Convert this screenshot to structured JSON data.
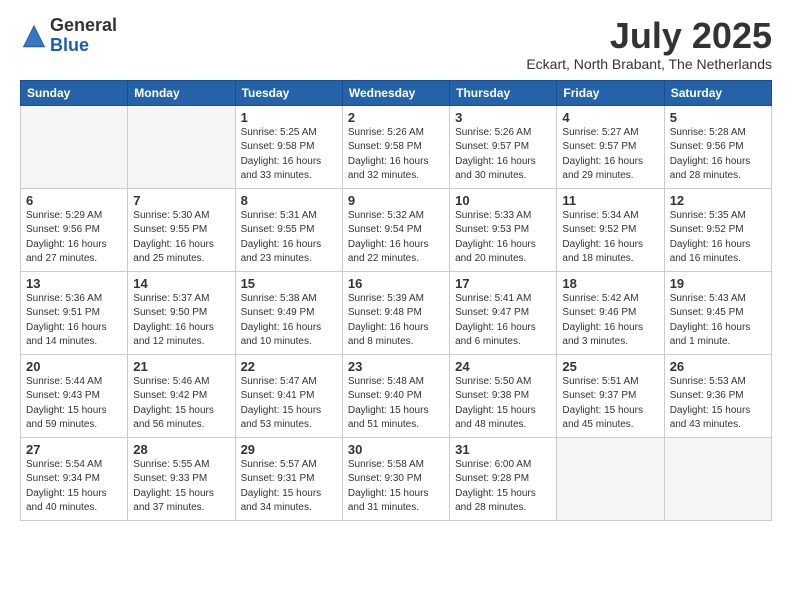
{
  "logo": {
    "general": "General",
    "blue": "Blue"
  },
  "title": "July 2025",
  "subtitle": "Eckart, North Brabant, The Netherlands",
  "headers": [
    "Sunday",
    "Monday",
    "Tuesday",
    "Wednesday",
    "Thursday",
    "Friday",
    "Saturday"
  ],
  "weeks": [
    [
      {
        "day": "",
        "info": ""
      },
      {
        "day": "",
        "info": ""
      },
      {
        "day": "1",
        "info": "Sunrise: 5:25 AM\nSunset: 9:58 PM\nDaylight: 16 hours\nand 33 minutes."
      },
      {
        "day": "2",
        "info": "Sunrise: 5:26 AM\nSunset: 9:58 PM\nDaylight: 16 hours\nand 32 minutes."
      },
      {
        "day": "3",
        "info": "Sunrise: 5:26 AM\nSunset: 9:57 PM\nDaylight: 16 hours\nand 30 minutes."
      },
      {
        "day": "4",
        "info": "Sunrise: 5:27 AM\nSunset: 9:57 PM\nDaylight: 16 hours\nand 29 minutes."
      },
      {
        "day": "5",
        "info": "Sunrise: 5:28 AM\nSunset: 9:56 PM\nDaylight: 16 hours\nand 28 minutes."
      }
    ],
    [
      {
        "day": "6",
        "info": "Sunrise: 5:29 AM\nSunset: 9:56 PM\nDaylight: 16 hours\nand 27 minutes."
      },
      {
        "day": "7",
        "info": "Sunrise: 5:30 AM\nSunset: 9:55 PM\nDaylight: 16 hours\nand 25 minutes."
      },
      {
        "day": "8",
        "info": "Sunrise: 5:31 AM\nSunset: 9:55 PM\nDaylight: 16 hours\nand 23 minutes."
      },
      {
        "day": "9",
        "info": "Sunrise: 5:32 AM\nSunset: 9:54 PM\nDaylight: 16 hours\nand 22 minutes."
      },
      {
        "day": "10",
        "info": "Sunrise: 5:33 AM\nSunset: 9:53 PM\nDaylight: 16 hours\nand 20 minutes."
      },
      {
        "day": "11",
        "info": "Sunrise: 5:34 AM\nSunset: 9:52 PM\nDaylight: 16 hours\nand 18 minutes."
      },
      {
        "day": "12",
        "info": "Sunrise: 5:35 AM\nSunset: 9:52 PM\nDaylight: 16 hours\nand 16 minutes."
      }
    ],
    [
      {
        "day": "13",
        "info": "Sunrise: 5:36 AM\nSunset: 9:51 PM\nDaylight: 16 hours\nand 14 minutes."
      },
      {
        "day": "14",
        "info": "Sunrise: 5:37 AM\nSunset: 9:50 PM\nDaylight: 16 hours\nand 12 minutes."
      },
      {
        "day": "15",
        "info": "Sunrise: 5:38 AM\nSunset: 9:49 PM\nDaylight: 16 hours\nand 10 minutes."
      },
      {
        "day": "16",
        "info": "Sunrise: 5:39 AM\nSunset: 9:48 PM\nDaylight: 16 hours\nand 8 minutes."
      },
      {
        "day": "17",
        "info": "Sunrise: 5:41 AM\nSunset: 9:47 PM\nDaylight: 16 hours\nand 6 minutes."
      },
      {
        "day": "18",
        "info": "Sunrise: 5:42 AM\nSunset: 9:46 PM\nDaylight: 16 hours\nand 3 minutes."
      },
      {
        "day": "19",
        "info": "Sunrise: 5:43 AM\nSunset: 9:45 PM\nDaylight: 16 hours\nand 1 minute."
      }
    ],
    [
      {
        "day": "20",
        "info": "Sunrise: 5:44 AM\nSunset: 9:43 PM\nDaylight: 15 hours\nand 59 minutes."
      },
      {
        "day": "21",
        "info": "Sunrise: 5:46 AM\nSunset: 9:42 PM\nDaylight: 15 hours\nand 56 minutes."
      },
      {
        "day": "22",
        "info": "Sunrise: 5:47 AM\nSunset: 9:41 PM\nDaylight: 15 hours\nand 53 minutes."
      },
      {
        "day": "23",
        "info": "Sunrise: 5:48 AM\nSunset: 9:40 PM\nDaylight: 15 hours\nand 51 minutes."
      },
      {
        "day": "24",
        "info": "Sunrise: 5:50 AM\nSunset: 9:38 PM\nDaylight: 15 hours\nand 48 minutes."
      },
      {
        "day": "25",
        "info": "Sunrise: 5:51 AM\nSunset: 9:37 PM\nDaylight: 15 hours\nand 45 minutes."
      },
      {
        "day": "26",
        "info": "Sunrise: 5:53 AM\nSunset: 9:36 PM\nDaylight: 15 hours\nand 43 minutes."
      }
    ],
    [
      {
        "day": "27",
        "info": "Sunrise: 5:54 AM\nSunset: 9:34 PM\nDaylight: 15 hours\nand 40 minutes."
      },
      {
        "day": "28",
        "info": "Sunrise: 5:55 AM\nSunset: 9:33 PM\nDaylight: 15 hours\nand 37 minutes."
      },
      {
        "day": "29",
        "info": "Sunrise: 5:57 AM\nSunset: 9:31 PM\nDaylight: 15 hours\nand 34 minutes."
      },
      {
        "day": "30",
        "info": "Sunrise: 5:58 AM\nSunset: 9:30 PM\nDaylight: 15 hours\nand 31 minutes."
      },
      {
        "day": "31",
        "info": "Sunrise: 6:00 AM\nSunset: 9:28 PM\nDaylight: 15 hours\nand 28 minutes."
      },
      {
        "day": "",
        "info": ""
      },
      {
        "day": "",
        "info": ""
      }
    ]
  ]
}
